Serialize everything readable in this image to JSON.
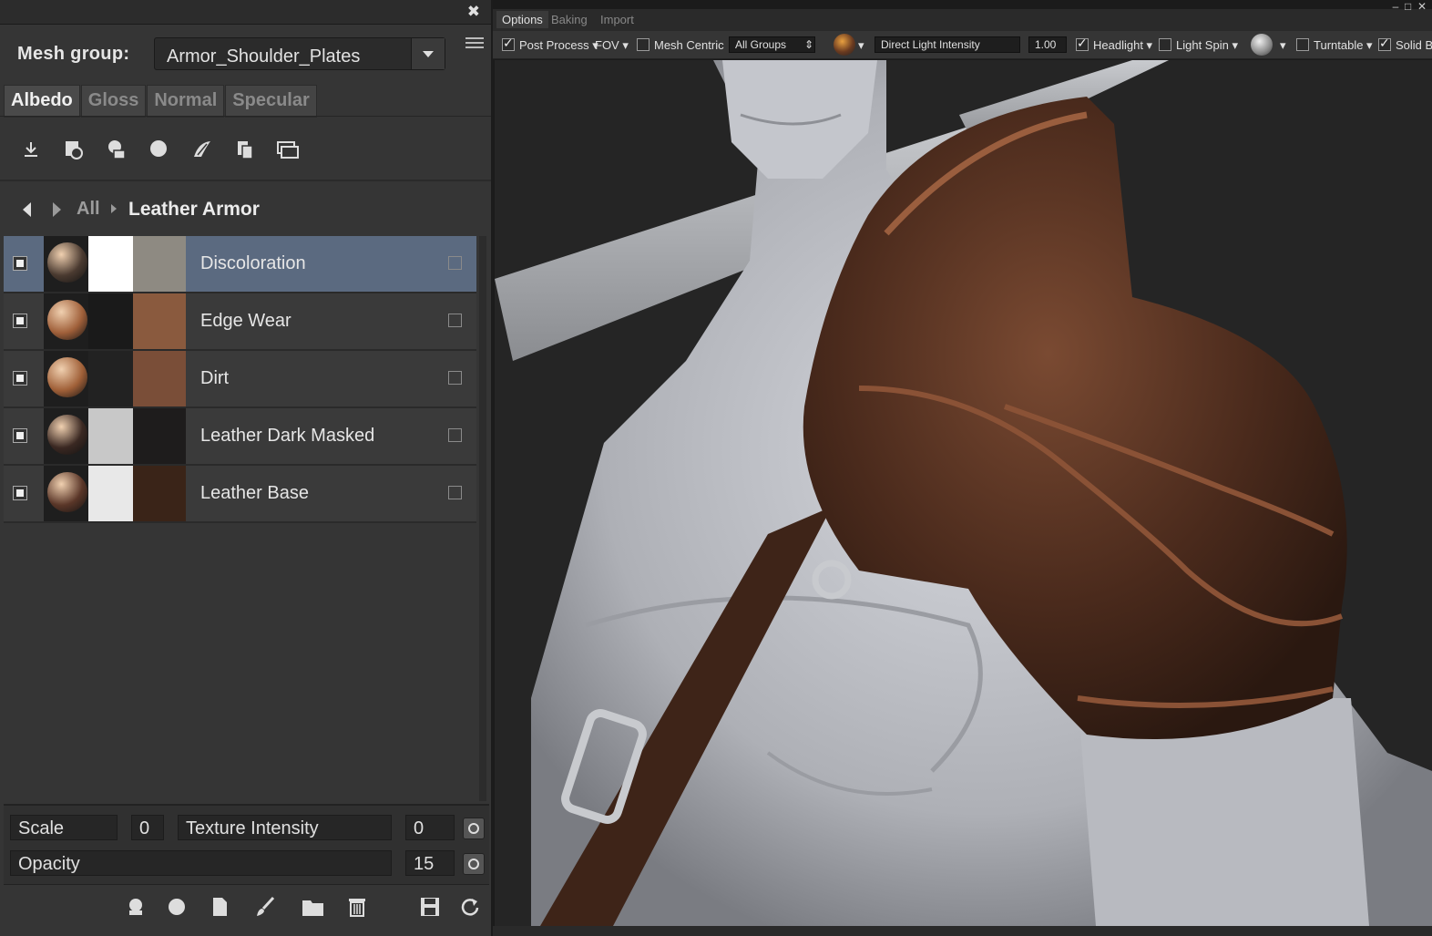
{
  "left_panel": {
    "mesh_group_label": "Mesh group:",
    "mesh_group_value": "Armor_Shoulder_Plates",
    "tabs": [
      {
        "label": "Albedo",
        "active": true
      },
      {
        "label": "Gloss",
        "active": false
      },
      {
        "label": "Normal",
        "active": false
      },
      {
        "label": "Specular",
        "active": false
      }
    ],
    "tool_icons": [
      "import-icon",
      "bake-icon",
      "material-icon",
      "refresh-material-icon",
      "paint-icon",
      "copy-icon",
      "duplicate-icon"
    ],
    "breadcrumb": {
      "root": "All",
      "current": "Leather Armor"
    },
    "layers": [
      {
        "name": "Discoloration",
        "selected": true,
        "ball_color": "#4a3a30",
        "mask": "#ffffff",
        "swatch": "#8e8a82"
      },
      {
        "name": "Edge Wear",
        "selected": false,
        "ball_color": "#a0603a",
        "mask": "#1a1a1a",
        "swatch": "#8a5a3e"
      },
      {
        "name": "Dirt",
        "selected": false,
        "ball_color": "#a06038",
        "mask": "#222222",
        "swatch": "#7a4e38"
      },
      {
        "name": "Leather Dark Masked",
        "selected": false,
        "ball_color": "#3a2822",
        "mask": "#c8c8c8",
        "swatch": "#1e1c1c"
      },
      {
        "name": "Leather Base",
        "selected": false,
        "ball_color": "#5a3628",
        "mask": "#e8e8e8",
        "swatch": "#3a2418"
      }
    ],
    "params": {
      "scale_label": "Scale",
      "scale_value": "0",
      "texture_intensity_label": "Texture Intensity",
      "texture_intensity_value": "0",
      "opacity_label": "Opacity",
      "opacity_value": "15"
    },
    "bottom_icons": [
      "sphere-icon",
      "circle-icon",
      "new-page-icon",
      "brush-icon",
      "folder-icon",
      "trash-icon",
      "save-icon",
      "reset-icon"
    ]
  },
  "viewer": {
    "tabs": [
      {
        "label": "Options",
        "active": true
      },
      {
        "label": "Baking",
        "active": false
      },
      {
        "label": "Import",
        "active": false
      }
    ],
    "toolbar": {
      "post_process": "Post Process",
      "fov": "FOV",
      "mesh_centric": "Mesh Centric",
      "groups": "All Groups",
      "light_intensity_label": "Direct Light Intensity",
      "light_intensity_value": "1.00",
      "headlight": "Headlight",
      "light_spin": "Light Spin",
      "turntable": "Turntable",
      "solid_bg": "Solid Ba"
    }
  },
  "colors": {
    "selected_row": "#5b6a80",
    "panel_bg": "#353535",
    "leather": "#5a3220"
  }
}
